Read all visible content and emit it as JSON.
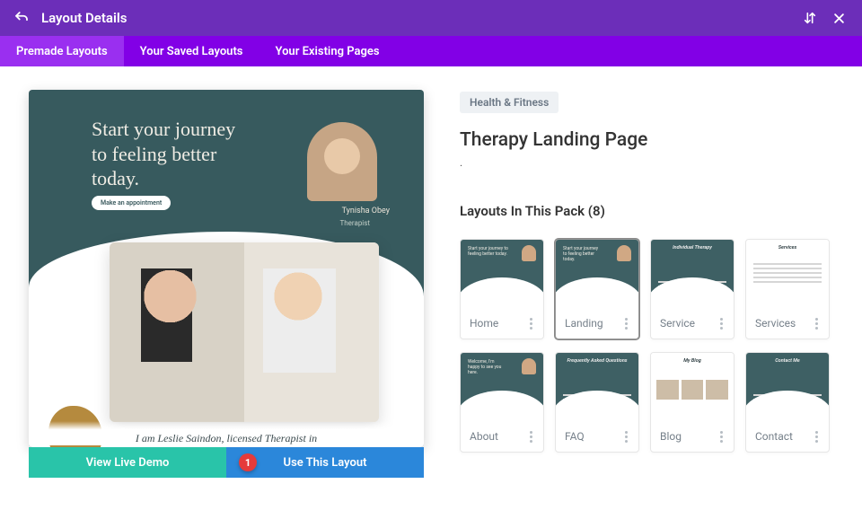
{
  "topbar": {
    "title": "Layout Details"
  },
  "tabs": {
    "premade": "Premade Layouts",
    "saved": "Your Saved Layouts",
    "existing": "Your Existing Pages"
  },
  "preview": {
    "hero_line1": "Start your journey",
    "hero_line2": "to feeling better",
    "hero_line3": "today.",
    "cta": "Make an appointment",
    "person_name": "Tynisha Obey",
    "person_role": "Therapist",
    "caption": "I am Leslie Saindon, licensed Therapist in"
  },
  "actions": {
    "demo": "View Live Demo",
    "use": "Use This Layout",
    "badge": "1"
  },
  "side": {
    "category": "Health & Fitness",
    "page_name": "Therapy Landing Page",
    "subdot": ".",
    "pack_title": "Layouts In This Pack (8)"
  },
  "cards": [
    {
      "label": "Home",
      "selected": false,
      "variant": "home"
    },
    {
      "label": "Landing",
      "selected": true,
      "variant": "landing"
    },
    {
      "label": "Service",
      "selected": false,
      "variant": "service"
    },
    {
      "label": "Services",
      "selected": false,
      "variant": "services"
    },
    {
      "label": "About",
      "selected": false,
      "variant": "about"
    },
    {
      "label": "FAQ",
      "selected": false,
      "variant": "faq"
    },
    {
      "label": "Blog",
      "selected": false,
      "variant": "blog"
    },
    {
      "label": "Contact",
      "selected": false,
      "variant": "contact"
    }
  ]
}
